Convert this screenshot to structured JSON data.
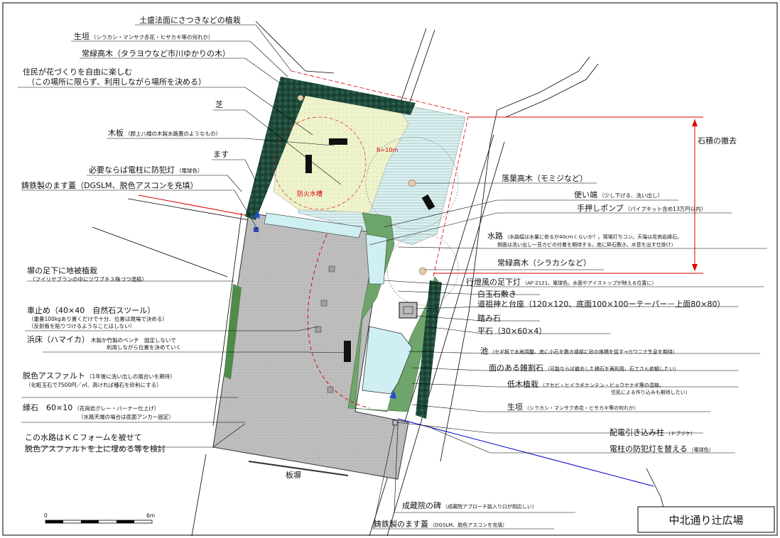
{
  "title": "中北通り辻広場",
  "scale": {
    "zero": "0",
    "end": "6m"
  },
  "dims": {
    "radius": "R=10m",
    "circle_note": "防火水槽",
    "stone_removal": "石積の撤去"
  },
  "labels_left": [
    {
      "main": "土盛法面にさつきなどの植栽"
    },
    {
      "main": "生垣",
      "note": "（シラカシ・マンサク赤花・ヒサカキ等の何れか）"
    },
    {
      "main": "常緑高木（タラヨウなど市川ゆかりの木）"
    },
    {
      "main": "住民が花づくりを自由に楽しむ"
    },
    {
      "main": "（この場所に限らず、利用しながら場所を決める）"
    },
    {
      "main": "芝"
    },
    {
      "main": "木板",
      "note": "（郡上八幡の木製水路蓋のようなもの）"
    },
    {
      "main": "ます"
    },
    {
      "main": "必要ならば電柱に防犯灯",
      "note": "（電球色）"
    },
    {
      "main": "鋳鉄製のます蓋（DGSLM、脱色アスコンを充填）"
    },
    {
      "main": "塀の足下に地被植栽"
    },
    {
      "main": "（フイリヤブランの中にツワブキ３株づつ混植）"
    },
    {
      "main": "車止め（40×40　自然石スツール）"
    },
    {
      "main": "（重量100kgあり置くだけで十分、位置は現場で決める）"
    },
    {
      "main": "（反射板を貼りつけるようなことはしない）"
    },
    {
      "main": "浜床（ハマイカ）",
      "note": "木製か竹製のベンチ　固定しないで"
    },
    {
      "main": "利用しながら位置を決めていく"
    },
    {
      "main": "脱色アスファルト",
      "note": "（1年後に洗い出しの風合いを期待）"
    },
    {
      "main": "（化粧玉石で7500円／㎡、高ければ種石を砂利にする）"
    },
    {
      "main": "縁石　60×10",
      "note": "（花崗岩グレー・バーナー仕上げ）"
    },
    {
      "main": "（水路天端の場合は底面アンカー固定）"
    },
    {
      "main": "この水路はＫＣフォームを被せて"
    },
    {
      "main": "脱色アスファルトを上に埋める等を検討"
    }
  ],
  "labels_right": [
    {
      "main": "落葉高木（モミジなど）"
    },
    {
      "main": "使い端",
      "note": "（少し下げる、洗い出し）"
    },
    {
      "main": "手押しポンプ",
      "note": "（パイプキット含め13万円以内）"
    },
    {
      "main": "水路",
      "note": "（水路幅は水量に依るが40cmくらいか？。現場打ちコン。天端は花崗岩縁石。"
    },
    {
      "main": "",
      "note": "側面は洗い出し一苔カビの付着を期待する。底に砕石敷き。水音を出す仕掛け）"
    },
    {
      "main": "常緑高木（シラカシなど）"
    },
    {
      "main": "行燈風の足下灯",
      "note": "（AF-2121、電球色。水面やアイストップが映える位置に）"
    },
    {
      "main": "白玉石敷き"
    },
    {
      "main": "道祖神と台座（120×120、底面100×100ーテーパー－上面80×80）"
    },
    {
      "main": "踏み石"
    },
    {
      "main": "平石（30×60×4）"
    },
    {
      "main": "池",
      "note": "（セギ板で水嵩調整、底に小石を敷き縁部に砂の堆積を促す→カワニナ生息を期待）"
    },
    {
      "main": "面のある雑割石",
      "note": "（可能ならば撤去した積石を再利用、石工さん依頼したい）"
    },
    {
      "main": "低木植栽",
      "note": "（アセビ・ヒイラギナンテン・ビョウヤナギ等の混植。"
    },
    {
      "main": "",
      "note": "住民による作り込みも期待したい）"
    },
    {
      "main": "生垣",
      "note": "（シラカシ・マンサク赤花・ヒサカキ等の何れか）"
    },
    {
      "main": "配電引き込み柱",
      "note": "（ドブヅケ）"
    },
    {
      "main": "電柱の防犯灯を替える",
      "note": "（電球色）"
    }
  ],
  "labels_bottom": [
    {
      "main": "板塀"
    },
    {
      "main": "成蔵院の碑",
      "note": "（成蔵院アプローチ路入り口が相応しい）"
    },
    {
      "main": "鋳鉄製のます蓋",
      "note": "（DGSLM、脱色アスコンを充填）"
    }
  ]
}
